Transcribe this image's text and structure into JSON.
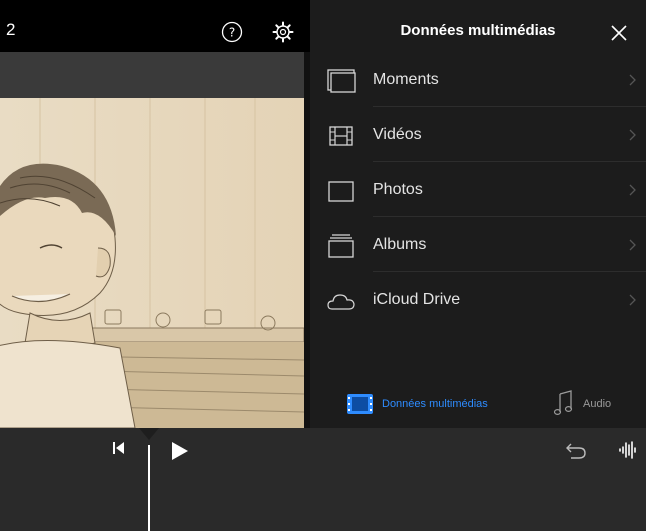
{
  "toolbar": {
    "project_number": "2",
    "help_icon": "question-mark-circle",
    "settings_icon": "gear-icon"
  },
  "viewer": {
    "content": "sketch-style photo of a smiling child"
  },
  "media_panel": {
    "title": "Données multimédias",
    "close_icon": "close-x",
    "items": [
      {
        "label": "Moments",
        "icon": "moments-icon"
      },
      {
        "label": "Vidéos",
        "icon": "film-icon"
      },
      {
        "label": "Photos",
        "icon": "photo-frame-icon"
      },
      {
        "label": "Albums",
        "icon": "album-stack-icon"
      },
      {
        "label": "iCloud Drive",
        "icon": "cloud-icon"
      }
    ],
    "tabs": {
      "media_label": "Données multimédias",
      "audio_label": "Audio"
    }
  },
  "timeline": {
    "controls": [
      "skip-to-start",
      "play",
      "undo",
      "audio-waveform"
    ]
  },
  "colors": {
    "accent": "#2e8cff",
    "panel_bg": "#1c1c1c",
    "timeline_bg": "#2a2a2a"
  }
}
